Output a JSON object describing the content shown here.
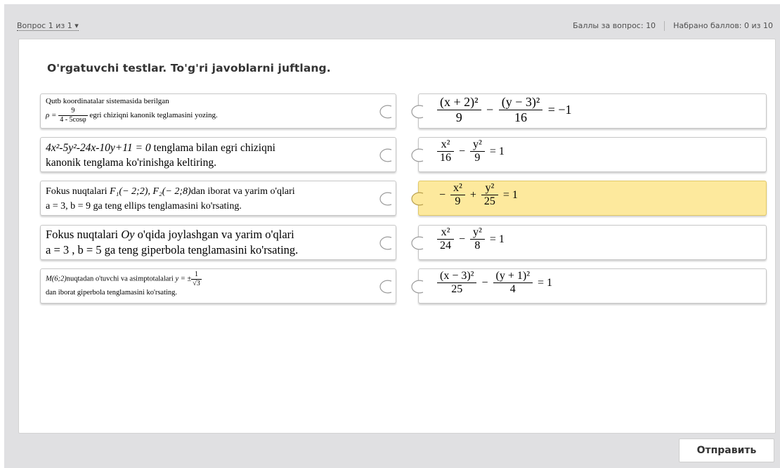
{
  "header": {
    "question_nav": "Вопрос 1 из 1",
    "points_per_question": "Баллы за вопрос: 10",
    "points_scored": "Набрано баллов: 0 из 10"
  },
  "question": {
    "title": "O'rgatuvchi testlar. To'g'ri javoblarni juftlang."
  },
  "left_items": [
    {
      "line1": "Qutb koordinatalar sistemasida berilgan",
      "rho": "ρ =",
      "frac_num": "9",
      "frac_den": "4 - 5cosφ",
      "line2_rest": "egri chiziqni kanonik teglamasini yozing."
    },
    {
      "equation": "4x²-5y²-24x-10y+11 = 0",
      "line1_rest": "tenglama bilan egri chiziqni",
      "line2": "kanonik tenglama ko'rinishga keltiring."
    },
    {
      "line1_start": "Fokus nuqtalari",
      "foci": "F₁(− 2;2), F₂(− 2;8)",
      "line1_end": "dan iborat va yarim o'qlari",
      "line2": "a = 3, b = 9 ga teng ellips tenglamasini ko'rsating."
    },
    {
      "line1_start": "Fokus nuqtalari",
      "axis": "Oy",
      "line1_end": "o'qida joylashgan va yarim o'qlari",
      "line2": "a = 3 , b = 5 ga teng giperbola tenglamasini ko'rsating."
    },
    {
      "point": "M(6;2)",
      "line1_mid": "nuqtadan o'tuvchi va asimptotalalari",
      "y_eq": "y = ±",
      "frac_num": "1",
      "frac_den": "√3",
      "line2": "dan iborat giperbola tenglamasini ko'rsating."
    }
  ],
  "right_items": [
    {
      "a_num": "(x + 2)²",
      "a_den": "9",
      "op": "−",
      "b_num": "(y − 3)²",
      "b_den": "16",
      "rhs": "= −1"
    },
    {
      "a_num": "x²",
      "a_den": "16",
      "op": "−",
      "b_num": "y²",
      "b_den": "9",
      "rhs": "= 1"
    },
    {
      "lead": "−",
      "a_num": "x²",
      "a_den": "9",
      "op": "+",
      "b_num": "y²",
      "b_den": "25",
      "rhs": "= 1"
    },
    {
      "a_num": "x²",
      "a_den": "24",
      "op": "−",
      "b_num": "y²",
      "b_den": "8",
      "rhs": "= 1"
    },
    {
      "a_num": "(x − 3)²",
      "a_den": "25",
      "op": "−",
      "b_num": "(y + 1)²",
      "b_den": "4",
      "rhs": "= 1"
    }
  ],
  "footer": {
    "submit_label": "Отправить"
  }
}
